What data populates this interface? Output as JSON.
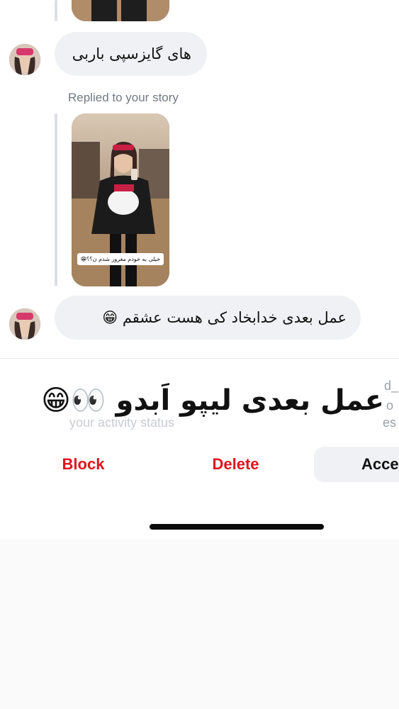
{
  "chat": {
    "messages": [
      {
        "text": "های گایزسپی باربی"
      },
      {
        "replied_label": "Replied to your story"
      },
      {
        "story_caption": "خیلی به خودم مغرور شدم ن؟؟😁"
      },
      {
        "text": "عمل بعدی خدابخاد کی هست عشقم 😁"
      }
    ]
  },
  "sheet": {
    "overlay_caption": "عمل بعدی لیپو اَبدو 👀😁",
    "peek_right_1": "d_",
    "peek_right_2": "o",
    "peek_right_3": "es",
    "peek_left": "your activity status",
    "actions": {
      "block_label": "Block",
      "delete_label": "Delete",
      "accept_label": "Acce"
    }
  },
  "colors": {
    "bubble_bg": "#eff1f4",
    "danger": "#e0141e",
    "muted": "#737a84",
    "button_bg": "#eff1f4"
  }
}
